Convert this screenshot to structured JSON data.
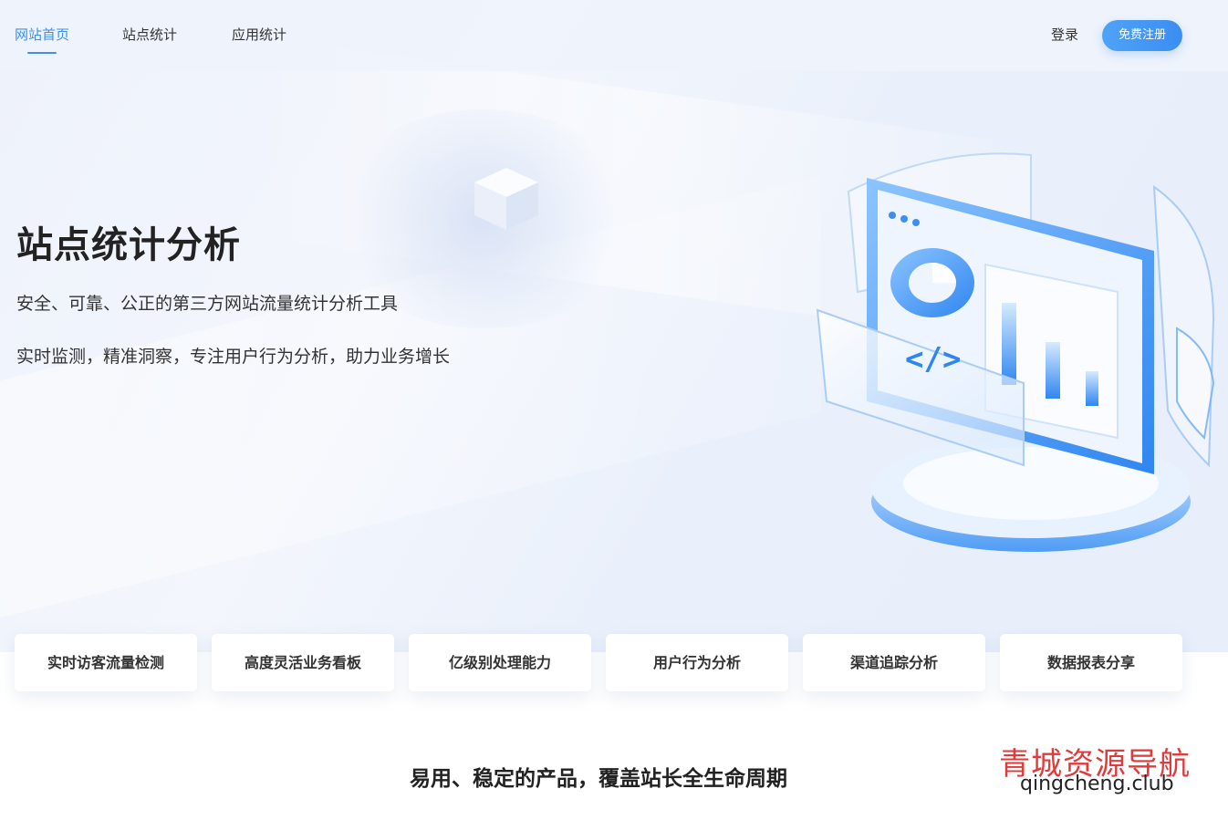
{
  "nav": {
    "items": [
      {
        "label": "网站首页",
        "active": true
      },
      {
        "label": "站点统计",
        "active": false
      },
      {
        "label": "应用统计",
        "active": false
      }
    ],
    "login_label": "登录",
    "register_label": "免费注册"
  },
  "hero": {
    "title": "站点统计分析",
    "subtitle1": "安全、可靠、公正的第三方网站流量统计分析工具",
    "subtitle2": "实时监测，精准洞察，专注用户行为分析，助力业务增长",
    "illustration_code_glyph": "</>"
  },
  "features": [
    "实时访客流量检测",
    "高度灵活业务看板",
    "亿级别处理能力",
    "用户行为分析",
    "渠道追踪分析",
    "数据报表分享"
  ],
  "section": {
    "title": "易用、稳定的产品，覆盖站长全生命周期"
  },
  "watermark": {
    "cn": "青城资源导航",
    "en": "qingcheng.club"
  },
  "colors": {
    "accent": "#3d8ef0",
    "watermark_red": "#e23a3a"
  }
}
